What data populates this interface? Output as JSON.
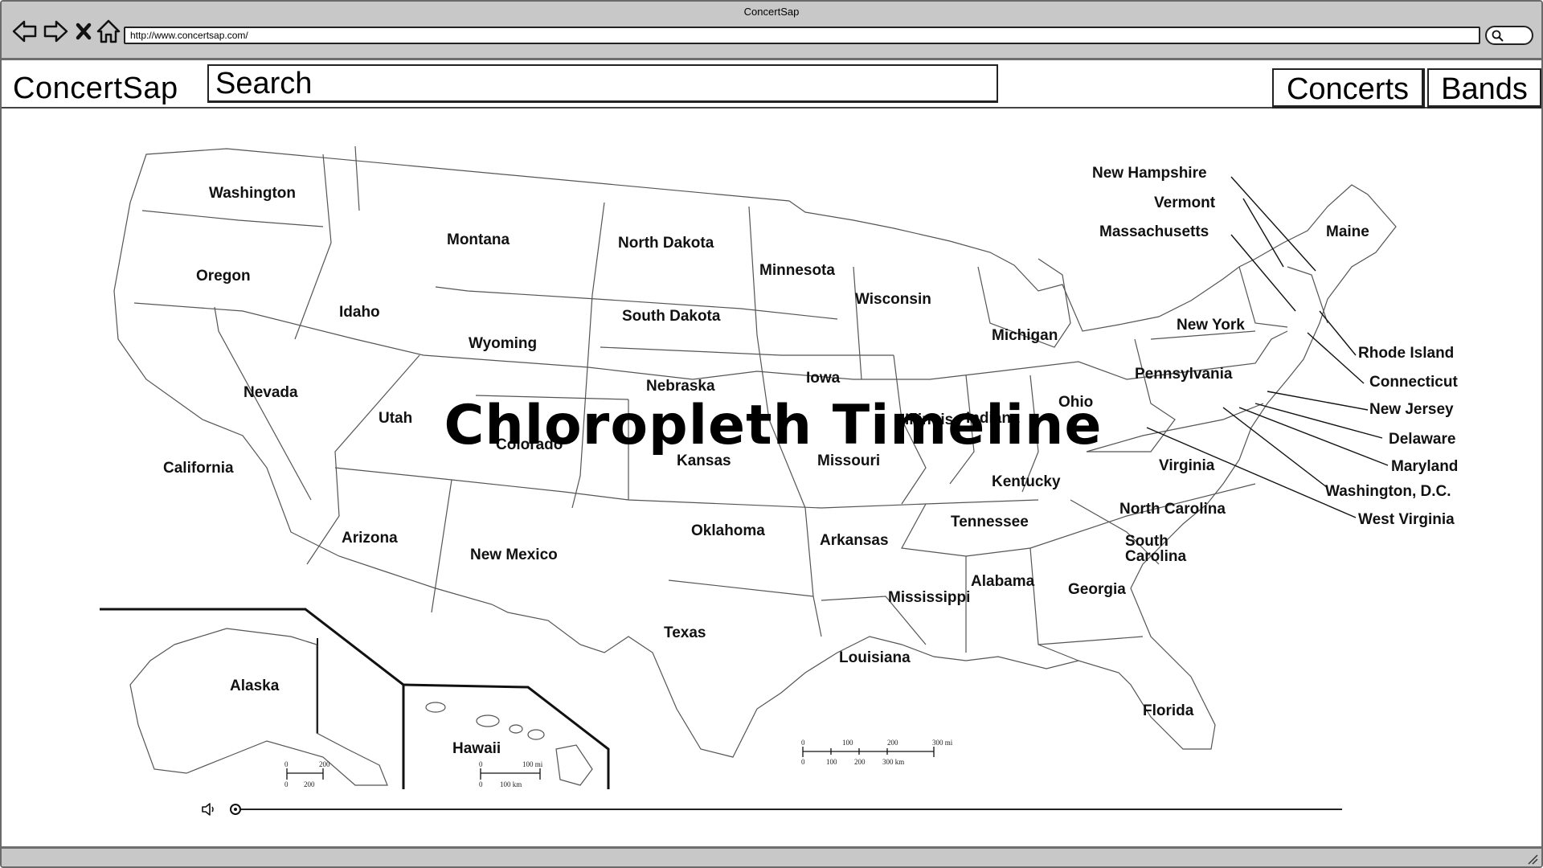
{
  "browser": {
    "window_title": "ConcertSap",
    "url": "http://www.concertsap.com/",
    "buttons": [
      "back-icon",
      "forward-icon",
      "stop-icon",
      "home-icon"
    ]
  },
  "app": {
    "logo": "ConcertSap",
    "search_placeholder": "Search",
    "nav": {
      "concerts": "Concerts",
      "bands": "Bands"
    }
  },
  "map": {
    "title": "Chloropleth Timeline",
    "states": {
      "washington": "Washington",
      "oregon": "Oregon",
      "california": "California",
      "idaho": "Idaho",
      "nevada": "Nevada",
      "montana": "Montana",
      "wyoming": "Wyoming",
      "utah": "Utah",
      "arizona": "Arizona",
      "colorado": "Colorado",
      "new_mexico": "New Mexico",
      "north_dakota": "North Dakota",
      "south_dakota": "South Dakota",
      "nebraska": "Nebraska",
      "kansas": "Kansas",
      "oklahoma": "Oklahoma",
      "texas": "Texas",
      "minnesota": "Minnesota",
      "iowa": "Iowa",
      "missouri": "Missouri",
      "arkansas": "Arkansas",
      "louisiana": "Louisiana",
      "wisconsin": "Wisconsin",
      "illinois": "Illinois",
      "michigan": "Michigan",
      "indiana": "Indiana",
      "ohio": "Ohio",
      "kentucky": "Kentucky",
      "tennessee": "Tennessee",
      "mississippi": "Mississippi",
      "alabama": "Alabama",
      "georgia": "Georgia",
      "florida": "Florida",
      "south_carolina_1": "South",
      "south_carolina_2": "Carolina",
      "north_carolina": "North Carolina",
      "virginia": "Virginia",
      "west_virginia": "West Virginia",
      "pennsylvania": "Pennsylvania",
      "new_york": "New York",
      "maine": "Maine",
      "new_hampshire": "New Hampshire",
      "vermont": "Vermont",
      "massachusetts": "Massachusetts",
      "rhode_island": "Rhode Island",
      "connecticut": "Connecticut",
      "new_jersey": "New Jersey",
      "delaware": "Delaware",
      "maryland": "Maryland",
      "washington_dc": "Washington, D.C.",
      "alaska": "Alaska",
      "hawaii": "Hawaii"
    },
    "scale_main": {
      "mi": [
        "0",
        "100",
        "200",
        "300 mi"
      ],
      "km": [
        "0",
        "100",
        "200",
        "300 km"
      ]
    },
    "scale_alaska": {
      "mi": [
        "0",
        "200"
      ],
      "km": [
        "0",
        "200"
      ]
    },
    "scale_hawaii": {
      "mi": [
        "0",
        "100 mi"
      ],
      "km": [
        "0",
        "100 km"
      ]
    }
  },
  "timeline": {
    "icon": "speaker-icon",
    "position": 0
  }
}
